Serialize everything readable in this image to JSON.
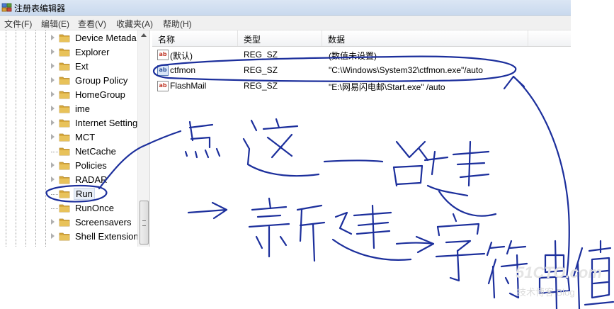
{
  "window": {
    "title": "注册表编辑器"
  },
  "menu": [
    "文件(F)",
    "编辑(E)",
    "查看(V)",
    "收藏夹(A)",
    "帮助(H)"
  ],
  "tree": {
    "items": [
      {
        "label": "Device Metada",
        "expandable": true,
        "selected": false
      },
      {
        "label": "Explorer",
        "expandable": true,
        "selected": false
      },
      {
        "label": "Ext",
        "expandable": true,
        "selected": false
      },
      {
        "label": "Group Policy",
        "expandable": true,
        "selected": false
      },
      {
        "label": "HomeGroup",
        "expandable": true,
        "selected": false
      },
      {
        "label": "ime",
        "expandable": true,
        "selected": false
      },
      {
        "label": "Internet Setting",
        "expandable": true,
        "selected": false
      },
      {
        "label": "MCT",
        "expandable": true,
        "selected": false
      },
      {
        "label": "NetCache",
        "expandable": false,
        "selected": false
      },
      {
        "label": "Policies",
        "expandable": true,
        "selected": false
      },
      {
        "label": "RADAR",
        "expandable": true,
        "selected": false
      },
      {
        "label": "Run",
        "expandable": false,
        "selected": true
      },
      {
        "label": "RunOnce",
        "expandable": false,
        "selected": false
      },
      {
        "label": "Screensavers",
        "expandable": true,
        "selected": false
      },
      {
        "label": "Shell Extension",
        "expandable": true,
        "selected": false
      }
    ]
  },
  "list": {
    "columns": [
      "名称",
      "类型",
      "数据"
    ],
    "rows": [
      {
        "name": "(默认)",
        "type": "REG_SZ",
        "data": "(数值未设置)",
        "selected": false
      },
      {
        "name": "ctfmon",
        "type": "REG_SZ",
        "data": "\"C:\\Windows\\System32\\ctfmon.exe\"/auto",
        "selected": true
      },
      {
        "name": "FlashMail",
        "type": "REG_SZ",
        "data": "\"E:\\网易闪电邮\\Start.exe\" /auto",
        "selected": false
      }
    ]
  },
  "icons": {
    "app": "registry-editor-icon",
    "folder": "folder-icon",
    "string_value": "string-value-icon",
    "expand": "expand-arrow-icon"
  },
  "watermark": {
    "site": "51CTO.com",
    "sub": "技术博客  Blog"
  },
  "colors": {
    "annotation_ink": "#1c2f9c",
    "folder": "#e8c25a",
    "titlebar": "#cfdcef"
  }
}
